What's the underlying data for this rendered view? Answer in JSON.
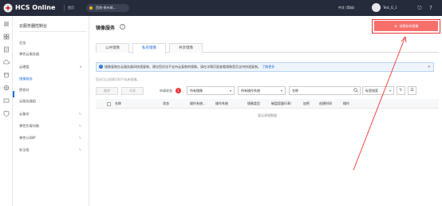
{
  "topbar": {
    "brand": "HCS Online",
    "home": "首页",
    "region": "西南-贵州城…",
    "language": "中文 (简体)",
    "user": "Test_G_1"
  },
  "iconrail": {
    "icons": [
      "menu-icon",
      "grid-icon",
      "server-icon",
      "cloud-icon",
      "database-icon",
      "network-icon",
      "storage-icon",
      "security-icon"
    ]
  },
  "sidebar": {
    "title": "云服务器控制台",
    "items": [
      {
        "label": "总览",
        "active": false
      },
      {
        "label": "弹性云服务器",
        "active": false
      },
      {
        "label": "云硬盘",
        "active": false,
        "caret": "▾"
      },
      {
        "label": "镜像服务",
        "active": true
      },
      {
        "label": "密钥对",
        "active": false
      },
      {
        "label": "云服务器组",
        "active": false
      },
      {
        "label": "云备份",
        "active": false,
        "pencil": "✎"
      },
      {
        "label": "弹性负载均衡",
        "active": false,
        "pencil": "✎"
      },
      {
        "label": "弹性公网IP",
        "active": false,
        "pencil": "✎"
      },
      {
        "label": "安全组",
        "active": false,
        "pencil": "✎"
      }
    ]
  },
  "main": {
    "title": "镜像服务",
    "create_button": "创建私有镜像",
    "tabs": [
      "公共镜像",
      "私有镜像",
      "共享镜像"
    ],
    "notice": {
      "text": "镜像复制在云服务器间快速复制，建议您优化不支持云复制的镜像。请在详情页面查看镜像是否支持快速复制。",
      "link": "了解更多"
    },
    "quota": "您还可以创建100个私有镜像。",
    "toolbar": {
      "delete": "删除",
      "share": "共享",
      "status_label": "申请状态",
      "status_count": "1",
      "select_image_type": "所有镜像",
      "select_os": "所有操作系统",
      "search_field": "名称",
      "tag_search": "标签搜索"
    },
    "table": {
      "columns": [
        "名称",
        "状态",
        "操作系统...",
        "操作系统",
        "镜像类型",
        "磁盘容量(GB)",
        "加密",
        "创建时间",
        "操作"
      ],
      "empty": "暂无表格数据"
    }
  }
}
